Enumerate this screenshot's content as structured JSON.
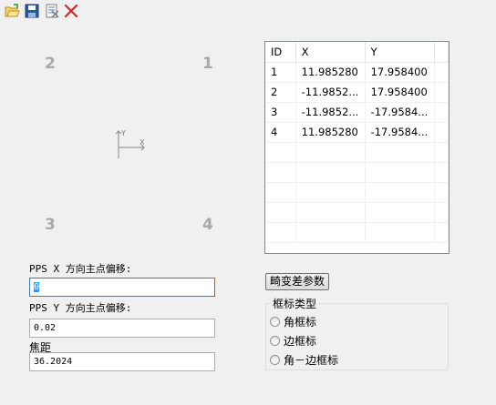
{
  "toolbar": {
    "icons": [
      "open-icon",
      "save-icon",
      "export-icon",
      "delete-icon"
    ]
  },
  "canvas": {
    "corners": [
      "2",
      "1",
      "3",
      "4"
    ],
    "axis": {
      "y_label": "Y",
      "x_label": "X"
    }
  },
  "form": {
    "pps_x_label": "PPS X 方向主点偏移:",
    "pps_x_value": "0",
    "pps_y_label": "PPS Y 方向主点偏移:",
    "pps_y_value": "0.02",
    "focal_label": "焦距",
    "focal_value": "36.2024"
  },
  "table": {
    "columns": [
      "ID",
      "X",
      "Y"
    ],
    "rows": [
      [
        "1",
        "11.985280",
        "17.958400"
      ],
      [
        "2",
        "-11.9852...",
        "17.958400"
      ],
      [
        "3",
        "-11.9852...",
        "-17.9584..."
      ],
      [
        "4",
        "11.985280",
        "-17.9584..."
      ]
    ]
  },
  "distortion_button": "畸变差参数",
  "frame_type": {
    "title": "框标类型",
    "options": [
      "角框标",
      "边框标",
      "角－边框标"
    ]
  },
  "colors": {
    "accent": "#3399ff",
    "delete": "#cc2b2b",
    "corner_number": "#a8a8a8"
  }
}
